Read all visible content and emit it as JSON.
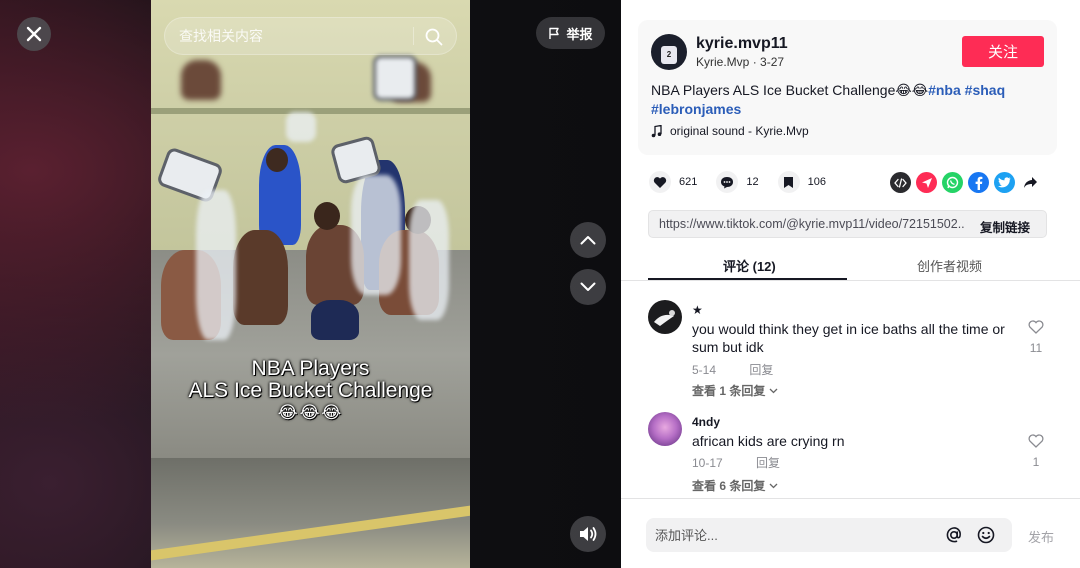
{
  "player": {
    "search_placeholder": "查找相关内容",
    "report_label": "举报",
    "caption_line1": "NBA Players",
    "caption_line2": "ALS Ice Bucket Challenge",
    "caption_emoji": "😂😂😂"
  },
  "post": {
    "username": "kyrie.mvp11",
    "nickname": "Kyrie.Mvp",
    "date": "3-27",
    "follow_label": "关注",
    "description": "NBA Players ALS Ice Bucket Challenge😂😂",
    "hashtags": [
      "#nba",
      "#shaq",
      "#lebronjames"
    ],
    "music": "original sound - Kyrie.Mvp",
    "likes": "621",
    "comments": "12",
    "saves": "106",
    "link": "https://www.tiktok.com/@kyrie.mvp11/video/72151502...",
    "copy_label": "复制链接"
  },
  "tabs": {
    "comments": "评论 (12)",
    "creator": "创作者视频"
  },
  "comment_list": [
    {
      "name": "★",
      "text": "you would think they get in ice baths all the time or sum but idk",
      "date": "5-14",
      "reply": "回复",
      "more": "查看 1 条回复",
      "likes": "11"
    },
    {
      "name": "4ndy",
      "text": "african kids are crying rn",
      "date": "10-17",
      "reply": "回复",
      "more": "查看 6 条回复",
      "likes": "1"
    }
  ],
  "composer": {
    "placeholder": "添加评论...",
    "post_label": "发布"
  },
  "colors": {
    "accent": "#fe2c55",
    "hashtag": "#2b5db8"
  }
}
